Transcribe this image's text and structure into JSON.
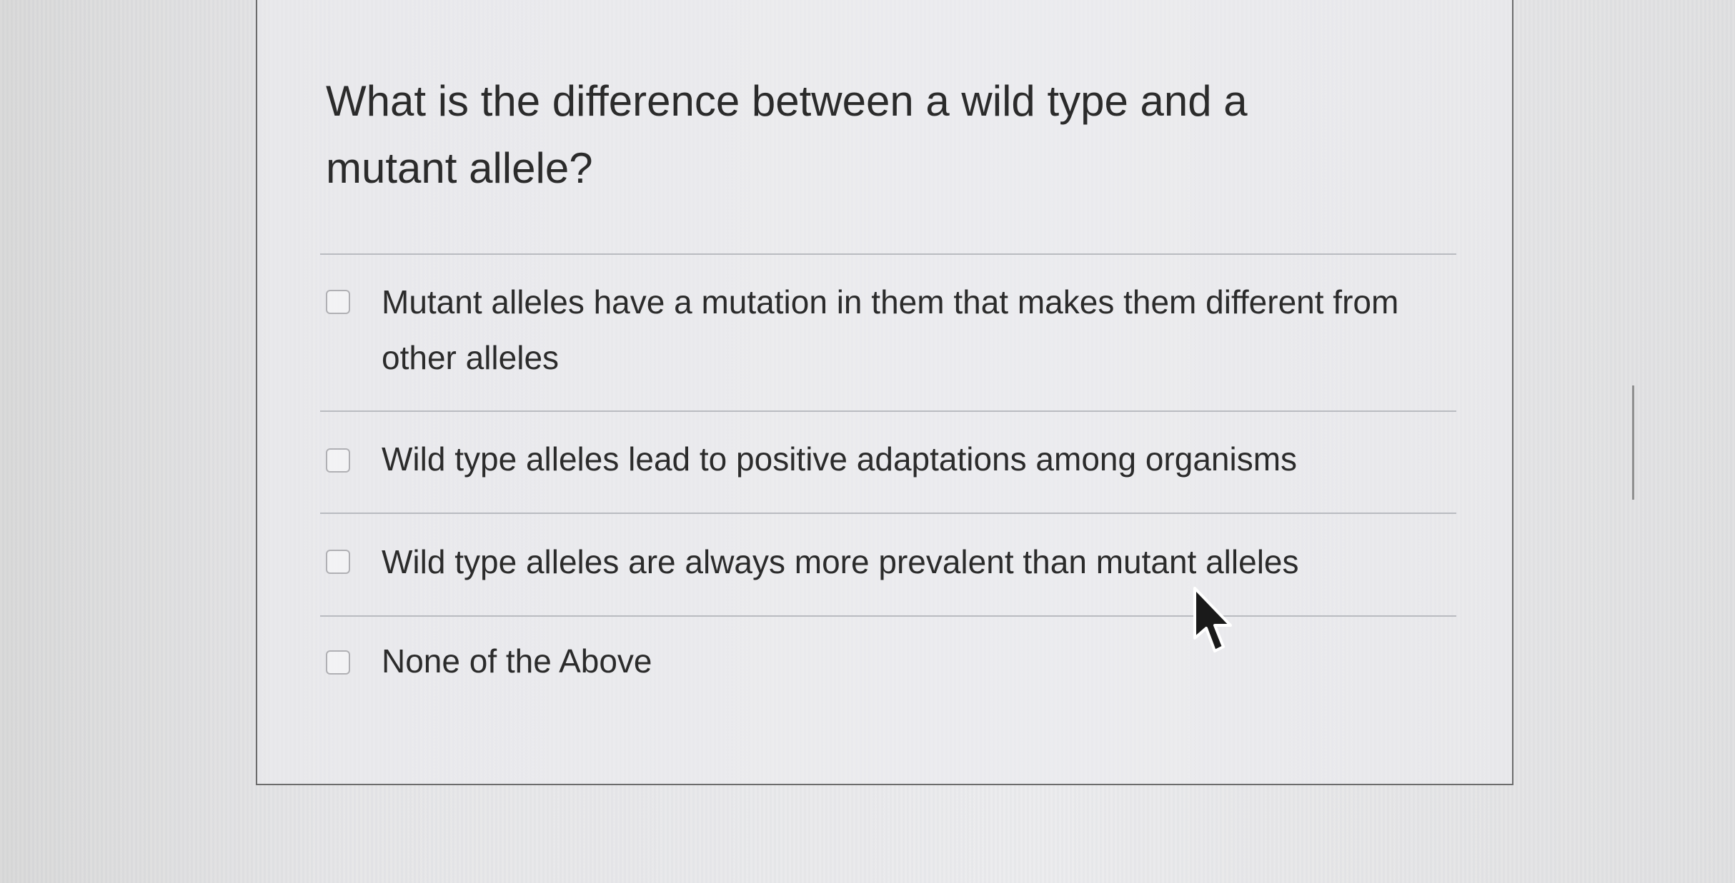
{
  "question": {
    "text": "What is the difference between a wild type and a mutant allele?"
  },
  "options": [
    {
      "label": "Mutant alleles have a mutation in them that makes them different from other alleles",
      "checked": false
    },
    {
      "label": "Wild type alleles lead to positive adaptations among organisms",
      "checked": false
    },
    {
      "label": "Wild type alleles are always more prevalent than mutant alleles",
      "checked": false
    },
    {
      "label": "None of the Above",
      "checked": false
    }
  ],
  "icons": {
    "cursor": "mouse-pointer-icon",
    "checkbox": "checkbox-icon"
  },
  "colors": {
    "text": "#2b2b2b",
    "divider": "#b9bbc0",
    "border": "#6c6c6c"
  }
}
